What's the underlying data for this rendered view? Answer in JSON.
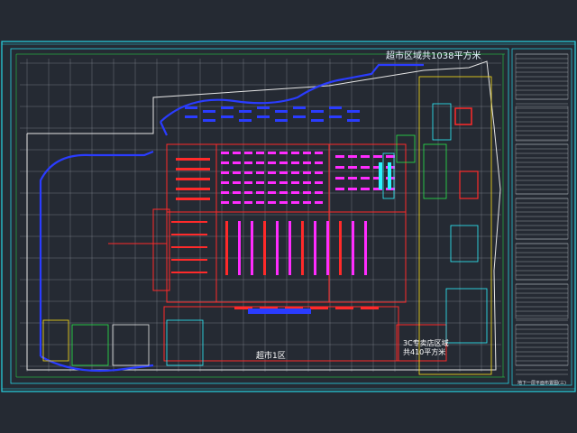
{
  "drawing": {
    "area_title": "超市区域共1038平方米",
    "zone_label": "超市1区",
    "shop_label_line1": "3C专卖店区域",
    "shop_label_line2": "共410平方米",
    "drawing_title": "地下一层平面布置图(三)"
  },
  "colors": {
    "background": "#252a33",
    "frame_cyan": "#27d6e6",
    "wall_white": "#e6e6e6",
    "grid_gray": "#8d949c",
    "magenta": "#ff2cff",
    "red": "#ff2a2a",
    "blue": "#2a3cff",
    "green": "#27e84a",
    "yellow": "#ffe21a",
    "cyan": "#2cf3ff"
  }
}
